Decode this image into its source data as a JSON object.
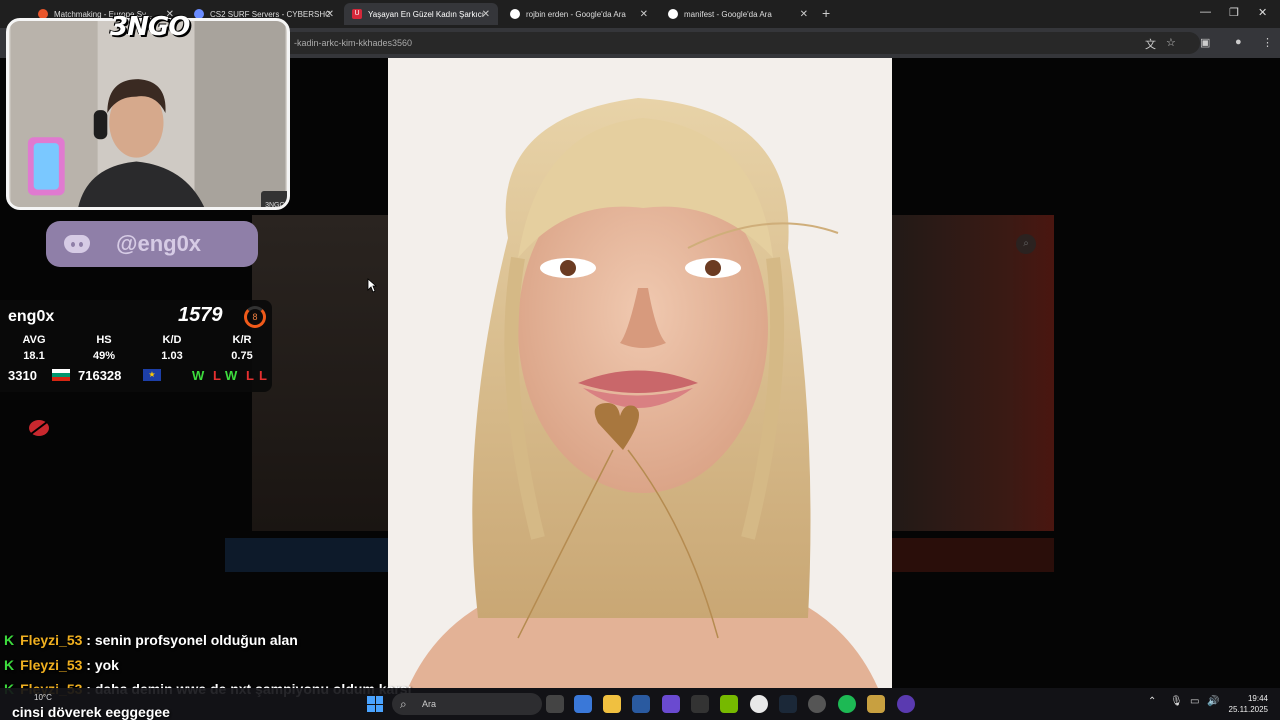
{
  "browser": {
    "tabs": [
      {
        "label": "Matchmaking - Europe Sy...",
        "active": false,
        "favicon_color": "#e8552a"
      },
      {
        "label": "CS2 SURF Servers - CYBERSHO",
        "active": false,
        "favicon_color": "#6a8cff"
      },
      {
        "label": "Yaşayan En Güzel Kadın Şarkıcı",
        "active": true,
        "favicon_color": "#d6283a",
        "favicon_letter": "U"
      },
      {
        "label": "rojbin erden - Google'da Ara",
        "active": false,
        "favicon_color": "#ffffff"
      },
      {
        "label": "manifest - Google'da Ara",
        "active": false,
        "favicon_color": "#ffffff"
      }
    ],
    "new_tab": "+",
    "url": "-kadin-arkc-kim-kkhades3560"
  },
  "overlay": {
    "logo": "3NGO",
    "cam_badge": "3NGO",
    "discord_handle": "@eng0x",
    "stats": {
      "name": "eng0x",
      "elo": "1579",
      "level": "8",
      "columns": [
        {
          "label": "AVG",
          "value": "18.1"
        },
        {
          "label": "HS",
          "value": "49%"
        },
        {
          "label": "K/D",
          "value": "1.03"
        },
        {
          "label": "K/R",
          "value": "0.75"
        }
      ],
      "country_rank": "3310",
      "region_rank": "716328",
      "region_label": "EU",
      "recent_results": [
        "W",
        "L",
        "W",
        "L",
        "L"
      ]
    }
  },
  "chat": [
    {
      "user": "Fleyzi_53",
      "message": ": senin profsyonel olduğun alan"
    },
    {
      "user": "Fleyzi_53",
      "message": ": yok"
    },
    {
      "user": "Fleyzi_53",
      "message": ": daha demin wwe de nxt şampiyonu oldum karşı"
    }
  ],
  "chat_wrap": "cinsi döverek eeggegee",
  "taskbar": {
    "weather_temp": "10°C",
    "search_placeholder": "Ara",
    "time": "19:44",
    "date": "25.11.2025"
  }
}
